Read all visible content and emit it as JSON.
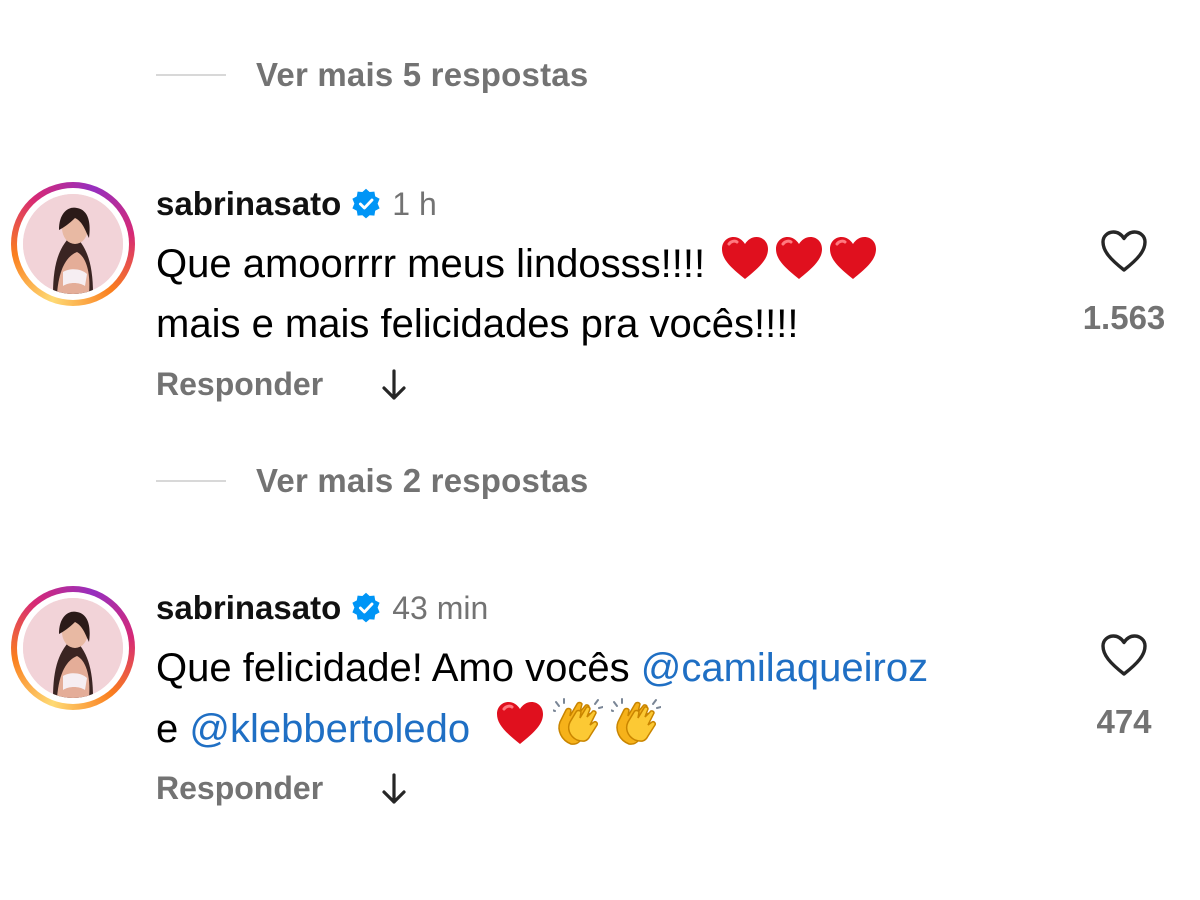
{
  "replies_top": {
    "label": "Ver mais 5 respostas"
  },
  "comments": [
    {
      "username": "sabrinasato",
      "time": "1 h",
      "line1": "Que amoorrrr meus lindosss!!!!",
      "line2": "mais e mais felicidades pra vocês!!!!",
      "reply_label": "Responder",
      "like_count": "1.563",
      "view_replies_label": "Ver mais 2 respostas"
    },
    {
      "username": "sabrinasato",
      "time": "43 min",
      "line1_text": "Que felicidade! Amo vocês ",
      "mention1": "@camilaqueiroz",
      "line2_text": "e ",
      "mention2": "@klebbertoledo",
      "reply_label": "Responder",
      "like_count": "474"
    }
  ],
  "colors": {
    "secondary_text": "#737373",
    "mention": "#1f6fc4",
    "verified": "#0095f6",
    "heart_emoji": "#e0101e"
  },
  "icons": [
    "verified-badge-icon",
    "heart-outline-icon",
    "arrow-down-icon",
    "red-heart-emoji",
    "clapping-hands-emoji"
  ]
}
